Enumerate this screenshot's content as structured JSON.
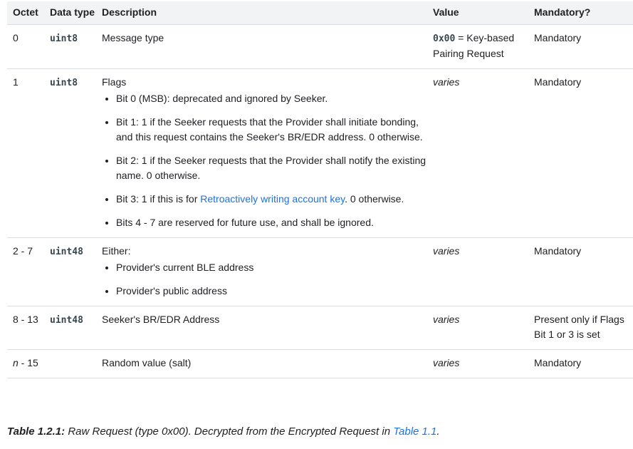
{
  "headers": [
    "Octet",
    "Data type",
    "Description",
    "Value",
    "Mandatory?"
  ],
  "rows": [
    {
      "octet": "0",
      "type": "uint8",
      "description": "Message type",
      "value_code": "0x00",
      "value_text": " = Key-based Pairing Request",
      "mandatory": "Mandatory"
    },
    {
      "octet": "1",
      "type": "uint8",
      "description": "Flags",
      "bits": [
        "Bit 0 (MSB): deprecated and ignored by Seeker.",
        "Bit 1: 1 if the Seeker requests that the Provider shall initiate bonding, and this request contains the Seeker's BR/EDR address. 0 otherwise.",
        "Bit 2: 1 if the Seeker requests that the Provider shall notify the existing name. 0 otherwise.",
        {
          "pre": "Bit 3: 1 if this is for ",
          "link": "Retroactively writing account key",
          "post": ". 0 otherwise."
        },
        "Bits 4 - 7 are reserved for future use, and shall be ignored."
      ],
      "value": "varies",
      "mandatory": "Mandatory"
    },
    {
      "octet": "2 - 7",
      "type": "uint48",
      "description": "Either:",
      "bits": [
        "Provider's current BLE address",
        "Provider's public address"
      ],
      "value": "varies",
      "mandatory": "Mandatory"
    },
    {
      "octet": "8 - 13",
      "type": "uint48",
      "description": "Seeker's BR/EDR Address",
      "value": "varies",
      "mandatory": "Present only if Flags Bit 1 or 3 is set"
    },
    {
      "octet_italic": "n",
      "octet_rest": " - 15",
      "type": "",
      "description": "Random value (salt)",
      "value": "varies",
      "mandatory": "Mandatory"
    }
  ],
  "caption": {
    "label": "Table 1.2.1:",
    "text": " Raw Request (type 0x00). Decrypted from the Encrypted Request in ",
    "link": "Table 1.1",
    "end": "."
  }
}
